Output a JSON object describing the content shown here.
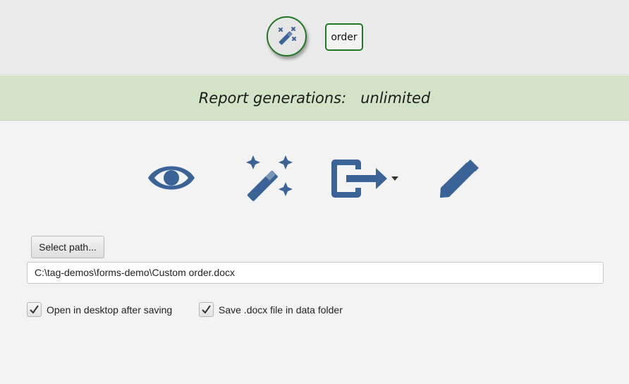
{
  "top": {
    "wand_icon": "magic-wand-icon",
    "tag_label": "order"
  },
  "banner": {
    "label": "Report generations:",
    "value": "unlimited"
  },
  "actions": [
    {
      "name": "preview",
      "icon": "eye-icon"
    },
    {
      "name": "generate",
      "icon": "magic-wand-icon"
    },
    {
      "name": "export",
      "icon": "export-icon"
    },
    {
      "name": "edit",
      "icon": "pencil-icon"
    }
  ],
  "path": {
    "select_label": "Select path...",
    "value": "C:\\tag-demos\\forms-demo\\Custom order.docx"
  },
  "options": {
    "open_after_saving": {
      "label": "Open in desktop after saving",
      "checked": true
    },
    "save_in_data_folder": {
      "label": "Save .docx file in data folder",
      "checked": true
    }
  },
  "colors": {
    "accent_green": "#1f7a22",
    "icon_blue": "#3a6497",
    "banner_bg": "#d2e3c8"
  }
}
